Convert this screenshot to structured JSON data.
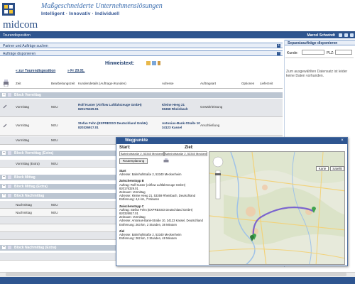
{
  "header": {
    "tagline": "Maßgeschneiderte Unternehmenslösungen",
    "subline": "Intelligent · Innovativ · Individuell",
    "logo_text": "midcom"
  },
  "navbar": {
    "section": "Tourendisposition",
    "user": "Marcel Schwindt"
  },
  "sections": {
    "partner": "Partner und Aufträge suchen",
    "dispose": "Aufträge disponieren"
  },
  "right_panel": {
    "title": "Separatzaufträge disponieren",
    "kunde_label": "Kunde:",
    "plz_label": "PLZ:",
    "note": "Zum ausgewählten Datensatz ist leider keine Daten vorhanden."
  },
  "main": {
    "hint_label": "Hinweistext:",
    "link_tour": "« zur Tourendisposition",
    "link_date": "» Fr 20.01."
  },
  "columns": [
    "Zeit",
    "Bearbeitungszeit",
    "Kundendetails (Auftrags-/Kunden)",
    "Adresse",
    "Auftragsart",
    "Optionen",
    "Lieferzeit"
  ],
  "groups": [
    {
      "label": "Block Vormittag"
    },
    {
      "label": "Block Vormittag (Extra)"
    },
    {
      "label": "Block Mittag"
    },
    {
      "label": "Block Mittag (Extra)"
    },
    {
      "label": "Block Nachmittag"
    },
    {
      "label": "Block Nachmittag (Extra)"
    }
  ],
  "rows": [
    {
      "time": "Vormittag",
      "status": "NEU",
      "customer": "Rolf Kuster (Airflow Luftfahrzeuge GmbH)",
      "id": "820176329.01",
      "street": "Kleine Heeg 21",
      "city": "55368 Rheinbach",
      "type": "Gewährleistung"
    },
    {
      "time": "Vormittag",
      "status": "NEU",
      "customer": "Stefan Fehn (EXPRESSO Deutschland GmbH)",
      "id": "820326917.01",
      "street": "Antonius-Bank-Straße 10",
      "city": "34123 Kassel",
      "type": "Anschließung"
    },
    {
      "time": "Vormittag",
      "status": "NEU"
    },
    {
      "time": "Vormittag (Extra)",
      "status": "NEU"
    },
    {
      "time": "Nachmittag",
      "status": "NEU"
    },
    {
      "time": "Nachmittag",
      "status": "NEU"
    }
  ],
  "dialog": {
    "title": "Wegpunkte",
    "start_label": "Start:",
    "ziel_label": "Ziel:",
    "start_value": "Bahnhofstraße 2, 53340 Meckenheim",
    "ziel_value": "Bahnhofstraße 2, 53340 Meckenheim",
    "route_button": "Routenplanung",
    "map_btn_karte": "Karte",
    "map_btn_satellit": "Satellit",
    "directions": [
      {
        "head": "Start",
        "lines": [
          "Adresse: Bahnhofstraße 2, 53340 Meckenheim"
        ]
      },
      {
        "head": "Zwischenstopp B",
        "lines": [
          "Auftrag: Rolf Kuster (Airflow Luftfahrzeuge GmbH)",
          "820176329.01",
          "Zeitraum: Vormittag",
          "Adresse: Kleine Heeg 21, 53359 Rheinbach, Deutschland",
          "Entfernung: 4,4 km, 7 Minuten"
        ]
      },
      {
        "head": "Zwischenstopp C",
        "lines": [
          "Auftrag: Stefan Fehn (EXPRESSO Deutschland GmbH)",
          "820326917.01",
          "Zeitraum: Vormittag",
          "Adresse: Antonius-Bank-Straße 10, 34123 Kassel, Deutschland",
          "Entfernung: 263 km, 2 Stunden, 38 Minuten"
        ]
      },
      {
        "head": "Ziel",
        "lines": [
          "Adresse: Bahnhofstraße 2, 53340 Meckenheim",
          "Entfernung: 262 km, 2 Stunden, 48 Minuten"
        ]
      }
    ]
  },
  "colors": {
    "primary": "#2e5590",
    "group_bar": "#bcc6d2",
    "route": "#6a4fd0"
  }
}
